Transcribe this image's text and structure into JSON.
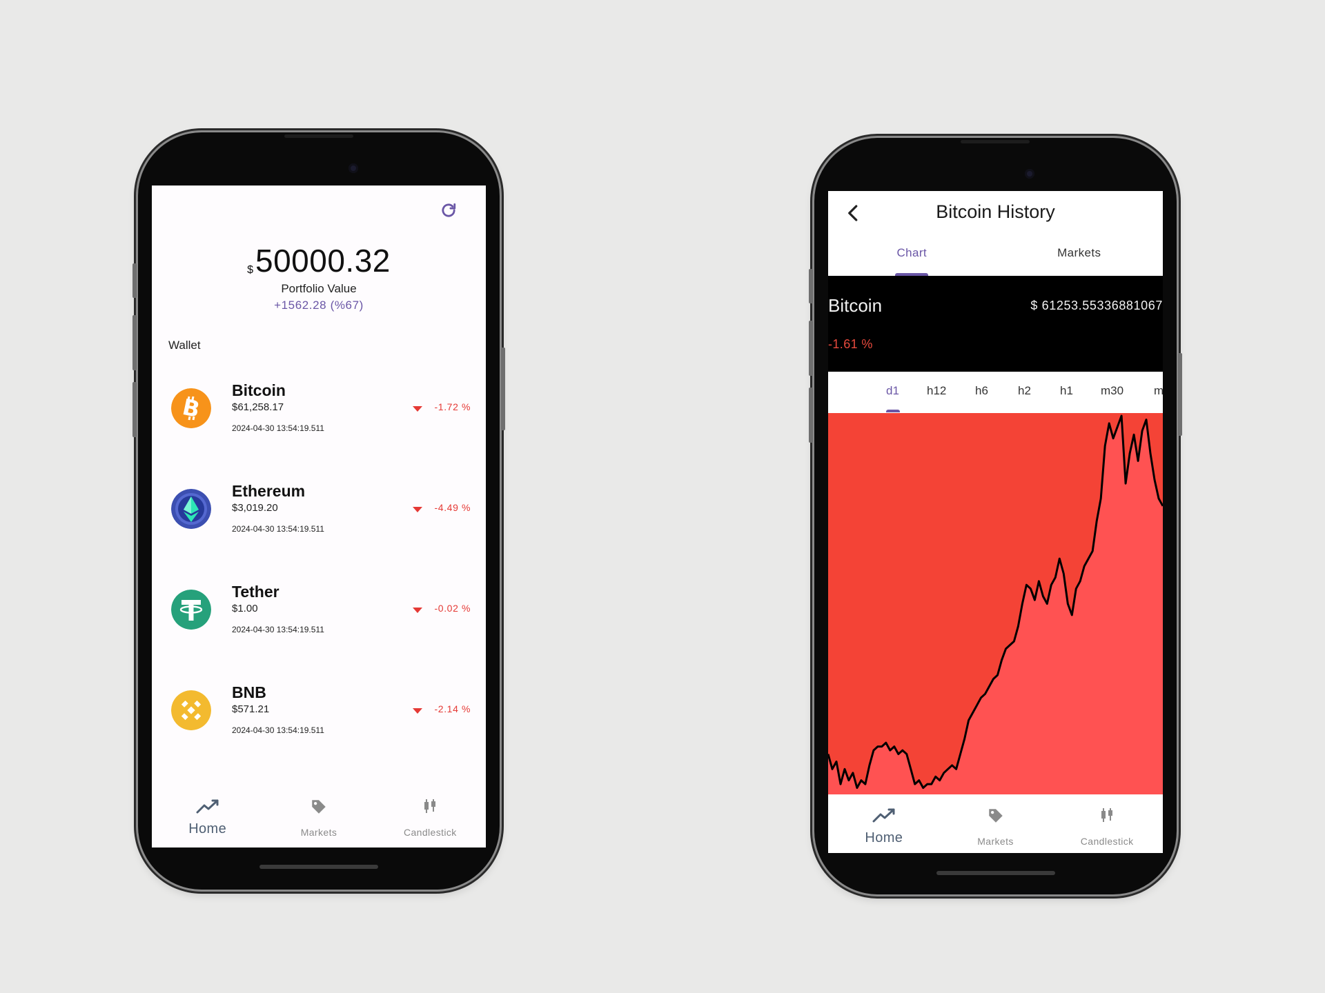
{
  "left": {
    "portfolio": {
      "currency": "$",
      "amount": "50000.32",
      "label": "Portfolio Value",
      "change": "+1562.28 (%67)"
    },
    "wallet_title": "Wallet",
    "refresh_icon": "refresh-icon",
    "coins": [
      {
        "name": "Bitcoin",
        "price": "$61,258.17",
        "time": "2024-04-30 13:54:19.511",
        "change": "-1.72 %",
        "icon": "bitcoin-icon",
        "color": "#f7931a"
      },
      {
        "name": "Ethereum",
        "price": "$3,019.20",
        "time": "2024-04-30 13:54:19.511",
        "change": "-4.49 %",
        "icon": "ethereum-icon",
        "color": "#3c4fb1"
      },
      {
        "name": "Tether",
        "price": "$1.00",
        "time": "2024-04-30 13:54:19.511",
        "change": "-0.02 %",
        "icon": "tether-icon",
        "color": "#26a17b"
      },
      {
        "name": "BNB",
        "price": "$571.21",
        "time": "2024-04-30 13:54:19.511",
        "change": "-2.14 %",
        "icon": "bnb-icon",
        "color": "#f3ba2f"
      }
    ],
    "nav": {
      "home": "Home",
      "markets": "Markets",
      "candlestick": "Candlestick"
    }
  },
  "right": {
    "title": "Bitcoin History",
    "tabs": {
      "chart": "Chart",
      "markets": "Markets"
    },
    "coin": {
      "name": "Bitcoin",
      "price": "$ 61253.55336881067",
      "change": "-1.61 %"
    },
    "intervals": [
      "d1",
      "h12",
      "h6",
      "h2",
      "h1",
      "m30",
      "m"
    ],
    "selected_interval": "d1",
    "nav": {
      "home": "Home",
      "markets": "Markets",
      "candlestick": "Candlestick"
    }
  },
  "colors": {
    "accent": "#6a56a6",
    "negative": "#e53935",
    "chart_background": "#f44336",
    "chart_fill": "#ff5252",
    "chart_line": "#000000"
  },
  "chart_data": {
    "type": "area",
    "title": "",
    "series": [
      {
        "values": [
          0.1,
          0.06,
          0.08,
          0.02,
          0.06,
          0.03,
          0.05,
          0.01,
          0.03,
          0.02,
          0.07,
          0.11,
          0.12,
          0.12,
          0.13,
          0.11,
          0.12,
          0.1,
          0.11,
          0.1,
          0.06,
          0.02,
          0.03,
          0.01,
          0.02,
          0.02,
          0.04,
          0.03,
          0.05,
          0.06,
          0.07,
          0.06,
          0.1,
          0.14,
          0.19,
          0.21,
          0.23,
          0.25,
          0.26,
          0.28,
          0.3,
          0.31,
          0.35,
          0.38,
          0.39,
          0.4,
          0.44,
          0.5,
          0.55,
          0.54,
          0.51,
          0.56,
          0.52,
          0.5,
          0.55,
          0.57,
          0.62,
          0.58,
          0.5,
          0.47,
          0.54,
          0.56,
          0.6,
          0.62,
          0.64,
          0.72,
          0.78,
          0.92,
          0.98,
          0.94,
          0.97,
          1.0,
          0.82,
          0.9,
          0.95,
          0.88,
          0.96,
          0.99,
          0.9,
          0.83,
          0.78,
          0.76
        ]
      }
    ],
    "ylim": [
      0,
      1
    ],
    "xlabel": "",
    "ylabel": "",
    "grid": false,
    "legend": "none"
  }
}
